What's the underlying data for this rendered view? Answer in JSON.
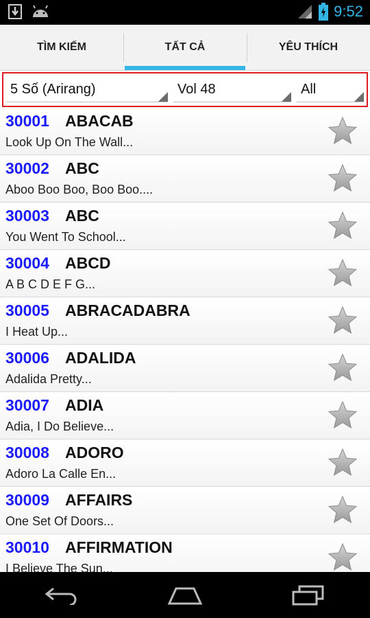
{
  "status_bar": {
    "time": "9:52",
    "icons": [
      "download-icon",
      "android-icon",
      "signal-icon",
      "battery-charging-icon"
    ]
  },
  "tabs": [
    {
      "label": "TÌM KIẾM",
      "active": false
    },
    {
      "label": "TẤT CẢ",
      "active": true
    },
    {
      "label": "YÊU THÍCH",
      "active": false
    }
  ],
  "filters": {
    "category": "5 Số (Arirang)",
    "volume": "Vol 48",
    "scope": "All"
  },
  "songs": [
    {
      "number": "30001",
      "title": "ABACAB",
      "lyric": "Look Up On The Wall..."
    },
    {
      "number": "30002",
      "title": "ABC",
      "lyric": "Aboo Boo Boo, Boo Boo...."
    },
    {
      "number": "30003",
      "title": "ABC",
      "lyric": "You Went To School..."
    },
    {
      "number": "30004",
      "title": "ABCD",
      "lyric": "A B C D E F G..."
    },
    {
      "number": "30005",
      "title": "ABRACADABRA",
      "lyric": "I Heat Up..."
    },
    {
      "number": "30006",
      "title": "ADALIDA",
      "lyric": "Adalida Pretty..."
    },
    {
      "number": "30007",
      "title": "ADIA",
      "lyric": "Adia, I Do Believe..."
    },
    {
      "number": "30008",
      "title": "ADORO",
      "lyric": "Adoro La Calle En..."
    },
    {
      "number": "30009",
      "title": "AFFAIRS",
      "lyric": "One Set Of Doors..."
    },
    {
      "number": "30010",
      "title": "AFFIRMATION",
      "lyric": "I Believe The Sun..."
    }
  ],
  "colors": {
    "accent": "#33b5e5",
    "song_number": "#1a1aff",
    "filter_border": "#e01b24"
  },
  "nav_bar": {
    "icons": [
      "back-icon",
      "home-icon",
      "recent-apps-icon"
    ]
  }
}
